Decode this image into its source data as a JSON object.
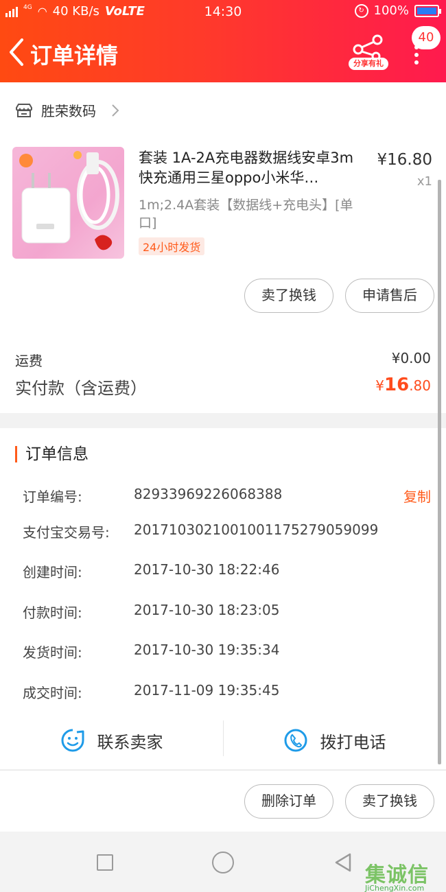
{
  "status_bar": {
    "network": "4G",
    "speed": "40 KB/s",
    "volte": "VoLTE",
    "time": "14:30",
    "battery": "100%"
  },
  "header": {
    "title": "订单详情",
    "share_label": "分享有礼",
    "badge_count": "40"
  },
  "store": {
    "name": "胜荣数码"
  },
  "product": {
    "title": "套装 1A-2A充电器数据线安卓3m快充通用三星oppo小米华…",
    "spec": "1m;2.4A套装【数据线+充电头】[单口]",
    "tag": "24小时发货",
    "price": "¥16.80",
    "quantity": "x1"
  },
  "actions_top": {
    "sell": "卖了换钱",
    "after_sale": "申请售后"
  },
  "summary": {
    "shipping_label": "运费",
    "shipping_value": "¥0.00",
    "paid_label": "实付款（含运费）",
    "paid_symbol": "¥",
    "paid_integer": "16",
    "paid_decimal": ".80"
  },
  "order_info": {
    "title": "订单信息",
    "copy_label": "复制",
    "rows": [
      {
        "label": "订单编号:",
        "value": "82933969226068388"
      },
      {
        "label": "支付宝交易号:",
        "value": "2017103021001001175279059099"
      },
      {
        "label": "创建时间:",
        "value": "2017-10-30 18:22:46"
      },
      {
        "label": "付款时间:",
        "value": "2017-10-30 18:23:05"
      },
      {
        "label": "发货时间:",
        "value": "2017-10-30 19:35:34"
      },
      {
        "label": "成交时间:",
        "value": "2017-11-09 19:35:45"
      }
    ]
  },
  "contact": {
    "seller": "联系卖家",
    "call": "拨打电话"
  },
  "actions_bottom": {
    "delete": "删除订单",
    "sell": "卖了换钱"
  },
  "watermark": {
    "main": "集诚信",
    "sub": "JiChengXin.com"
  },
  "colors": {
    "accent": "#ff5a1a",
    "header_start": "#ff4a12",
    "header_end": "#ff1a4e",
    "icon_blue": "#1e9be8"
  }
}
